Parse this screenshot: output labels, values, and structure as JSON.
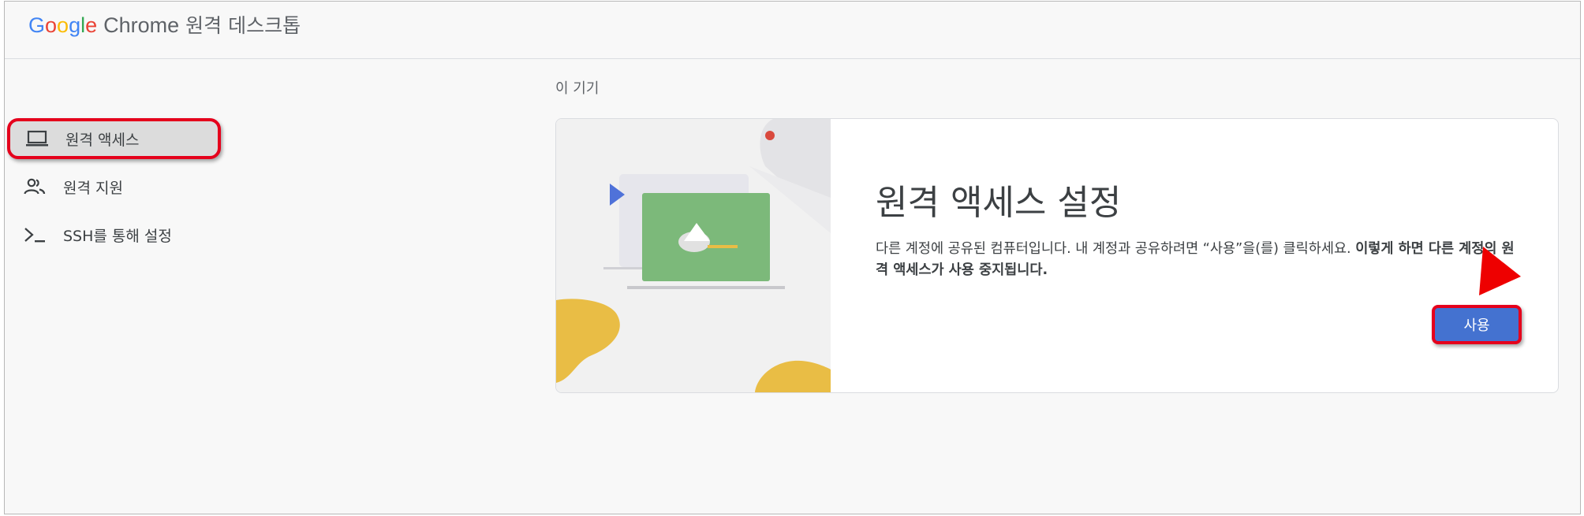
{
  "header": {
    "logo_letters": [
      {
        "ch": "G",
        "color": "#4285F4"
      },
      {
        "ch": "o",
        "color": "#EA4335"
      },
      {
        "ch": "o",
        "color": "#FBBC05"
      },
      {
        "ch": "g",
        "color": "#4285F4"
      },
      {
        "ch": "l",
        "color": "#34A853"
      },
      {
        "ch": "e",
        "color": "#EA4335"
      }
    ],
    "logo_chrome": "Chrome",
    "product_name": "원격 데스크톱"
  },
  "sidebar": {
    "items": [
      {
        "label": "원격 액세스",
        "icon": "laptop-icon",
        "active": true
      },
      {
        "label": "원격 지원",
        "icon": "people-icon",
        "active": false
      },
      {
        "label": "SSH를 통해 설정",
        "icon": "terminal-icon",
        "active": false
      }
    ]
  },
  "main": {
    "section_label": "이 기기",
    "card": {
      "title": "원격 액세스 설정",
      "description_normal": "다른 계정에 공유된 컴퓨터입니다. 내 계정과 공유하려면 “사용”을(를) 클릭하세요. ",
      "description_bold": "이렇게 하면 다른 계정의 원격 액세스가 사용 중지됩니다.",
      "button_label": "사용"
    }
  },
  "colors": {
    "accent_blue": "#4472d0",
    "highlight_red": "#e5001c",
    "illustration_green": "#7cb97a",
    "illustration_yellow": "#e9bd45"
  }
}
